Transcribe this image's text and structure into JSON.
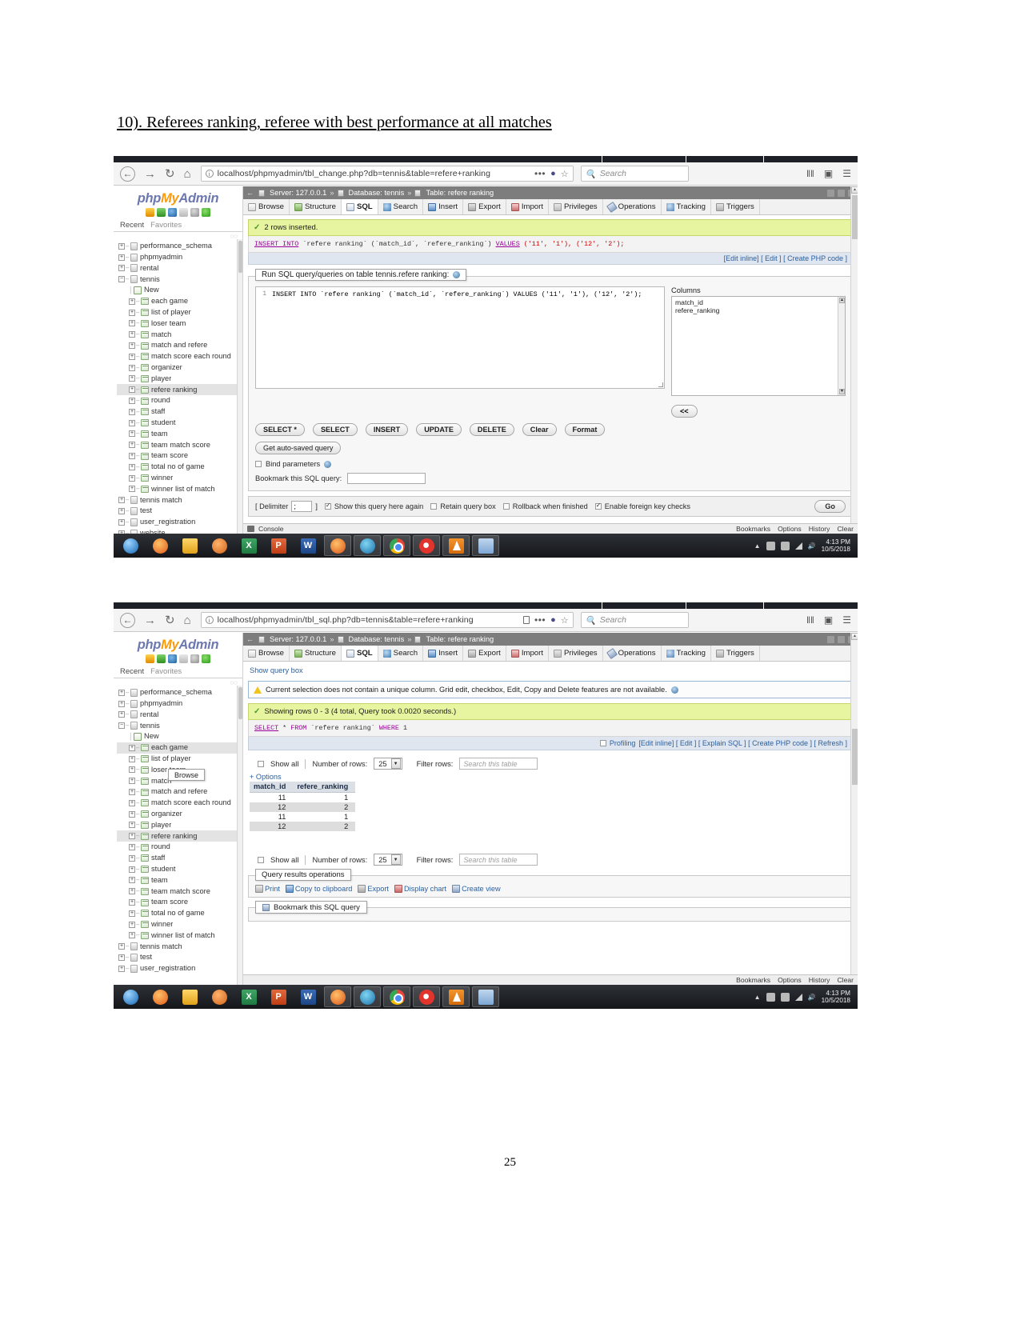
{
  "document": {
    "heading": "10). Referees ranking, referee with best performance at all matches",
    "page_number": "25"
  },
  "shot1": {
    "browser": {
      "back_icon": "←",
      "forward_icon": "→",
      "reload_icon": "↻",
      "home_icon": "⌂",
      "url": "localhost/phpmyadmin/tbl_change.php?db=tennis&table=refere+ranking",
      "dots": "•••",
      "search_placeholder": "Search",
      "menu_icon": "☰",
      "library_icon": "‖‖",
      "sync_icon": "▣"
    },
    "sidebar": {
      "logo_php": "php",
      "logo_my": "My",
      "logo_admin": "Admin",
      "recent": "Recent",
      "favorites": "Favorites",
      "databases": [
        {
          "label": "performance_schema",
          "type": "db"
        },
        {
          "label": "phpmyadmin",
          "type": "db"
        },
        {
          "label": "rental",
          "type": "db"
        },
        {
          "label": "tennis",
          "type": "db",
          "expanded": true
        }
      ],
      "tennis_tables": [
        "New",
        "each game",
        "list of player",
        "loser team",
        "match",
        "match and refere",
        "match score each round",
        "organizer",
        "player",
        "refere ranking",
        "round",
        "staff",
        "student",
        "team",
        "team match score",
        "team score",
        "total no of game",
        "winner",
        "winner list of match"
      ],
      "selected_table": "refere ranking",
      "databases_after": [
        "tennis match",
        "test",
        "user_registration",
        "website"
      ]
    },
    "breadcrumb": {
      "back_arrow": "←",
      "server": "Server: 127.0.0.1",
      "database": "Database: tennis",
      "table": "Table: refere ranking",
      "sep": "»"
    },
    "tabs": [
      {
        "label": "Browse",
        "icon": "browse-icon",
        "active": false
      },
      {
        "label": "Structure",
        "icon": "structure-icon",
        "active": false
      },
      {
        "label": "SQL",
        "icon": "sql-icon",
        "active": true
      },
      {
        "label": "Search",
        "icon": "search-icon",
        "active": false
      },
      {
        "label": "Insert",
        "icon": "insert-icon",
        "active": false
      },
      {
        "label": "Export",
        "icon": "export-icon",
        "active": false
      },
      {
        "label": "Import",
        "icon": "import-icon",
        "active": false
      },
      {
        "label": "Privileges",
        "icon": "privileges-icon",
        "active": false
      },
      {
        "label": "Operations",
        "icon": "operations-icon",
        "active": false
      },
      {
        "label": "Tracking",
        "icon": "tracking-icon",
        "active": false
      },
      {
        "label": "Triggers",
        "icon": "triggers-icon",
        "active": false
      }
    ],
    "notice": {
      "text": "2 rows inserted.",
      "check_icon": "✓"
    },
    "executed_sql": {
      "kw1": "INSERT INTO",
      "rest": " `refere ranking` (`match_id`, `refere_ranking`) ",
      "kw2": "VALUES",
      "values": " ('11', '1'), ('12', '2');",
      "full": "INSERT INTO `refere ranking` (`match_id`, `refere_ranking`) VALUES ('11', '1'), ('12', '2');"
    },
    "sql_actions": "[Edit inline] [ Edit ] [ Create PHP code ]",
    "query_panel": {
      "legend": "Run SQL query/queries on table tennis.refere ranking:",
      "line_no": "1",
      "code": "INSERT INTO `refere ranking` (`match_id`, `refere_ranking`) VALUES ('11', '1'), ('12', '2');",
      "columns_title": "Columns",
      "columns": [
        "match_id",
        "refere_ranking"
      ],
      "collapse_label": "<<"
    },
    "buttons": [
      "SELECT *",
      "SELECT",
      "INSERT",
      "UPDATE",
      "DELETE",
      "Clear",
      "Format"
    ],
    "autosave_button": "Get auto-saved query",
    "bind_parameters": "Bind parameters",
    "bookmark_label": "Bookmark this SQL query:",
    "bookmark_value": "",
    "delimiter": {
      "open": "[ Delimiter",
      "value": ";",
      "close": "]",
      "options": [
        {
          "label": "Show this query here again",
          "checked": true
        },
        {
          "label": "Retain query box",
          "checked": false
        },
        {
          "label": "Rollback when finished",
          "checked": false
        },
        {
          "label": "Enable foreign key checks",
          "checked": true
        }
      ],
      "go": "Go"
    },
    "footer": {
      "console": "Console",
      "links": [
        "Bookmarks",
        "Options",
        "History",
        "Clear"
      ]
    },
    "taskbar": {
      "clock_time": "4:13 PM",
      "clock_date": "10/5/2018"
    }
  },
  "shot2": {
    "browser": {
      "back_icon": "←",
      "forward_icon": "→",
      "reload_icon": "↻",
      "home_icon": "⌂",
      "url": "localhost/phpmyadmin/tbl_sql.php?db=tennis&table=refere+ranking",
      "dots": "•••",
      "search_placeholder": "Search",
      "menu_icon": "☰",
      "library_icon": "‖‖",
      "sync_icon": "▣"
    },
    "sidebar": {
      "logo_php": "php",
      "logo_my": "My",
      "logo_admin": "Admin",
      "recent": "Recent",
      "favorites": "Favorites",
      "databases": [
        {
          "label": "performance_schema",
          "type": "db"
        },
        {
          "label": "phpmyadmin",
          "type": "db"
        },
        {
          "label": "rental",
          "type": "db"
        },
        {
          "label": "tennis",
          "type": "db",
          "expanded": true
        }
      ],
      "tennis_tables": [
        "New",
        "each game",
        "list of player",
        "loser team",
        "match",
        "match and refere",
        "match score each round",
        "organizer",
        "player",
        "refere ranking",
        "round",
        "staff",
        "student",
        "team",
        "team match score",
        "team score",
        "total no of game",
        "winner",
        "winner list of match"
      ],
      "hovered_table": "each game",
      "selected_table": "refere ranking",
      "tooltip": "Browse",
      "databases_after": [
        "tennis match",
        "test",
        "user_registration"
      ]
    },
    "breadcrumb": {
      "back_arrow": "←",
      "server": "Server: 127.0.0.1",
      "database": "Database: tennis",
      "table": "Table: refere ranking",
      "sep": "»"
    },
    "tabs": [
      {
        "label": "Browse",
        "icon": "browse-icon",
        "active": false
      },
      {
        "label": "Structure",
        "icon": "structure-icon",
        "active": false
      },
      {
        "label": "SQL",
        "icon": "sql-icon",
        "active": true
      },
      {
        "label": "Search",
        "icon": "search-icon",
        "active": false
      },
      {
        "label": "Insert",
        "icon": "insert-icon",
        "active": false
      },
      {
        "label": "Export",
        "icon": "export-icon",
        "active": false
      },
      {
        "label": "Import",
        "icon": "import-icon",
        "active": false
      },
      {
        "label": "Privileges",
        "icon": "privileges-icon",
        "active": false
      },
      {
        "label": "Operations",
        "icon": "operations-icon",
        "active": false
      },
      {
        "label": "Tracking",
        "icon": "tracking-icon",
        "active": false
      },
      {
        "label": "Triggers",
        "icon": "triggers-icon",
        "active": false
      }
    ],
    "show_query_box": "Show query box",
    "warning": "Current selection does not contain a unique column. Grid edit, checkbox, Edit, Copy and Delete features are not available.",
    "notice": {
      "text": "Showing rows 0 - 3 (4 total, Query took 0.0020 seconds.)",
      "check_icon": "✓"
    },
    "executed_sql": {
      "kw1": "SELECT",
      "mid": " * ",
      "kw2": "FROM",
      "obj": " `refere ranking` ",
      "kw3": "WHERE",
      "tail": " 1",
      "full": "SELECT * FROM `refere ranking` WHERE 1"
    },
    "result_actions": {
      "profiling": "Profiling",
      "links": "[Edit inline] [ Edit ] [ Explain SQL ] [ Create PHP code ] [ Refresh ]"
    },
    "options_top": {
      "show_all": "Show all",
      "rows_label": "Number of rows:",
      "rows_value": "25",
      "filter_label": "Filter rows:",
      "filter_placeholder": "Search this table"
    },
    "options_link": "+ Options",
    "table": {
      "columns": [
        "match_id",
        "refere_ranking"
      ],
      "rows": [
        [
          "11",
          "1"
        ],
        [
          "12",
          "2"
        ],
        [
          "11",
          "1"
        ],
        [
          "12",
          "2"
        ]
      ]
    },
    "options_bottom": {
      "show_all": "Show all",
      "rows_label": "Number of rows:",
      "rows_value": "25",
      "filter_label": "Filter rows:",
      "filter_placeholder": "Search this table"
    },
    "query_ops": {
      "legend": "Query results operations",
      "links": [
        "Print",
        "Copy to clipboard",
        "Export",
        "Display chart",
        "Create view"
      ]
    },
    "bookmark_fs": {
      "legend": "Bookmark this SQL query"
    },
    "footer": {
      "links": [
        "Bookmarks",
        "Options",
        "History",
        "Clear"
      ]
    },
    "status_url": "localhost/phpmyadmin/sql.php?server=1&db=tennis&table=each+game&pos=0",
    "taskbar": {
      "clock_time": "4:13 PM",
      "clock_date": "10/5/2018"
    }
  },
  "taskbar_apps": [
    {
      "name": "start-button",
      "icon": "i-start",
      "label": ""
    },
    {
      "name": "firefox-taskbar",
      "icon": "i-ff",
      "label": ""
    },
    {
      "name": "file-explorer-taskbar",
      "icon": "i-folder",
      "label": ""
    },
    {
      "name": "media-player-taskbar",
      "icon": "i-media",
      "label": ""
    },
    {
      "name": "excel-taskbar",
      "icon": "i-xl",
      "label": "X"
    },
    {
      "name": "powerpoint-taskbar",
      "icon": "i-pp",
      "label": "P"
    },
    {
      "name": "word-taskbar",
      "icon": "i-wd",
      "label": "W"
    },
    {
      "name": "firefox-window-taskbar",
      "icon": "i-ff2",
      "label": ""
    },
    {
      "name": "edge-taskbar",
      "icon": "i-edge",
      "label": ""
    },
    {
      "name": "chrome-taskbar",
      "icon": "i-chrome",
      "label": ""
    },
    {
      "name": "opera-taskbar",
      "icon": "i-opera",
      "label": ""
    },
    {
      "name": "vlc-taskbar",
      "icon": "i-vlc",
      "label": ""
    },
    {
      "name": "explorer-window-taskbar",
      "icon": "i-expl",
      "label": ""
    }
  ]
}
